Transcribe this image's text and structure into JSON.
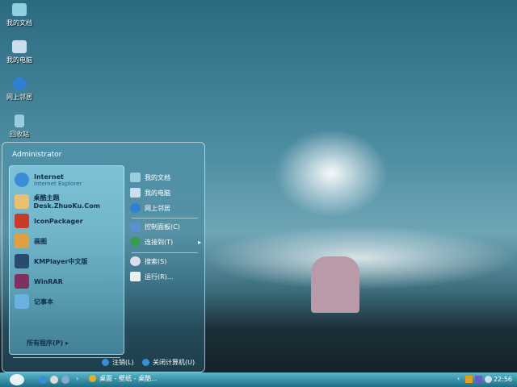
{
  "desktop_icons": [
    {
      "label": "我的文档",
      "icon": "folder-icon"
    },
    {
      "label": "我的电脑",
      "icon": "computer-icon"
    },
    {
      "label": "网上邻居",
      "icon": "network-icon"
    },
    {
      "label": "回收站",
      "icon": "recycle-bin-icon"
    }
  ],
  "start_menu": {
    "user": "Administrator",
    "pinned": [
      {
        "title": "Internet",
        "subtitle": "Internet Explorer"
      },
      {
        "title": "桌酷主题Desk.ZhuoKu.Com"
      },
      {
        "title": "IconPackager"
      },
      {
        "title": "画图"
      },
      {
        "title": "KMPlayer中文版"
      },
      {
        "title": "WinRAR"
      },
      {
        "title": "记事本"
      }
    ],
    "all_programs": "所有程序(P)",
    "right": [
      "我的文档",
      "我的电脑",
      "网上邻居",
      "控制面板(C)",
      "连接到(T)",
      "搜索(S)",
      "运行(R)..."
    ],
    "logoff": "注销(L)",
    "shutdown": "关闭计算机(U)"
  },
  "taskbar": {
    "task": "桌面 - 壁纸 - 桌酷...",
    "clock": "22:56"
  },
  "colors": {
    "taskbar": "#1d6f85",
    "accent": "#3a8ed8"
  }
}
